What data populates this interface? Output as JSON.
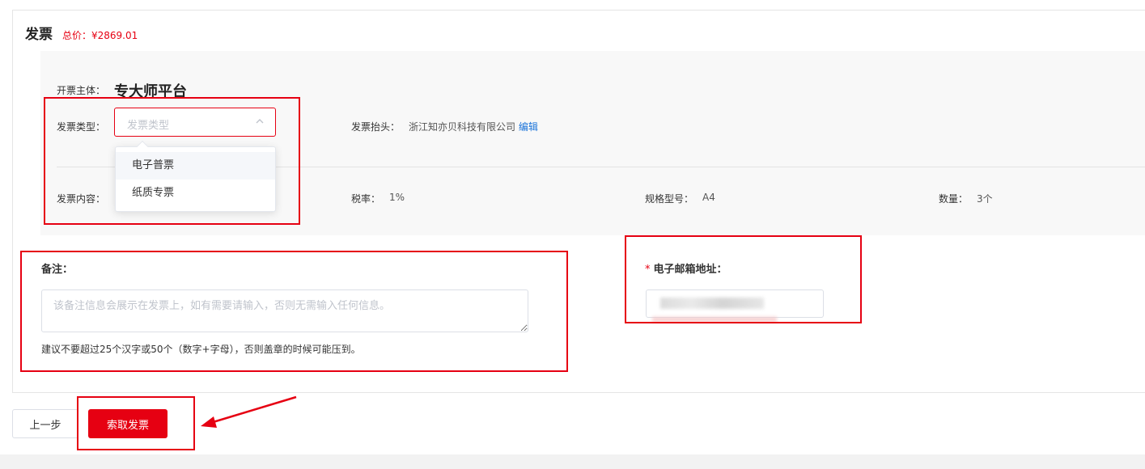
{
  "header": {
    "title": "发票",
    "total_price": "总价：¥2869.01"
  },
  "invoice_info": {
    "issuer_label": "开票主体：",
    "issuer_value": "专大师平台",
    "type_label": "发票类型：",
    "type_select": {
      "placeholder": "发票类型",
      "options": [
        "电子普票",
        "纸质专票"
      ],
      "hovered_option": "电子普票"
    },
    "header_label": "发票抬头：",
    "header_value": "浙江知亦贝科技有限公司",
    "edit_link": "编辑",
    "content_label": "发票内容：",
    "tax_label": "税率：",
    "tax_value": "1%",
    "spec_label": "规格型号：",
    "spec_value": "A4",
    "qty_label": "数量：",
    "qty_value": "3个"
  },
  "remark": {
    "label": "备注：",
    "placeholder": "该备注信息会展示在发票上，如有需要请输入，否则无需输入任何信息。",
    "hint": "建议不要超过25个汉字或50个（数字+字母），否则盖章的时候可能压到。"
  },
  "email": {
    "required_mark": "*",
    "label": "电子邮箱地址："
  },
  "actions": {
    "prev_label": "上一步",
    "submit_label": "索取发票"
  },
  "colors": {
    "accent": "#e60012",
    "link": "#1a73d9",
    "panel_bg": "#f8f8f8"
  }
}
